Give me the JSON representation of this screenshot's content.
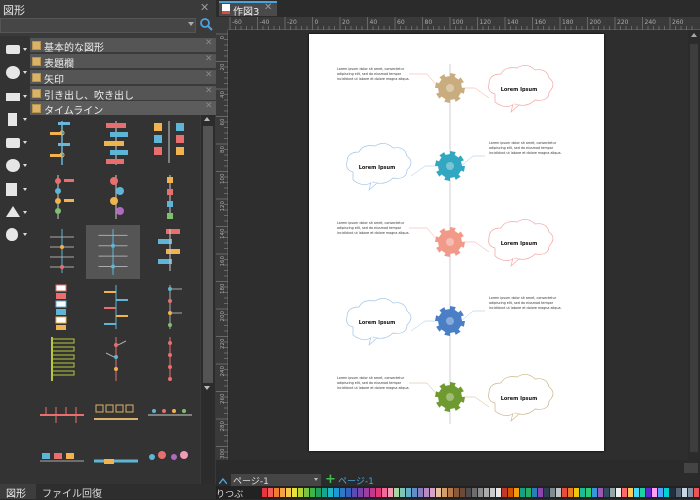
{
  "left_panel": {
    "title": "図形",
    "close": "✕",
    "libraries": [
      {
        "label": "基本的な図形",
        "close": "✕"
      },
      {
        "label": "表題欄",
        "close": "✕"
      },
      {
        "label": "矢印",
        "close": "✕"
      },
      {
        "label": "引き出し、吹き出し",
        "close": "✕"
      },
      {
        "label": "タイムライン",
        "close": "✕"
      }
    ],
    "category_icons": [
      "rectangle-icon",
      "pie-chart-icon",
      "truck-icon",
      "device-icon",
      "camera-icon",
      "heart-badge-icon",
      "people-icon",
      "triangle-shapes-icon",
      "apple-icon"
    ],
    "bottom_tabs": [
      "図形",
      "ファイル回復"
    ]
  },
  "document": {
    "tab_label": "作図3",
    "tab_close": "✕",
    "ruler_h_labels": [
      "-60",
      "-40",
      "-20",
      "0",
      "20",
      "40",
      "60",
      "80",
      "100",
      "120",
      "140",
      "160",
      "180",
      "200",
      "220",
      "240",
      "260"
    ],
    "ruler_v_labels": [
      "0",
      "20",
      "40",
      "60",
      "80",
      "100",
      "120",
      "140",
      "160",
      "180",
      "200",
      "220",
      "240",
      "260",
      "280",
      "300"
    ]
  },
  "timeline": {
    "body_text": [
      "Lorem ipsum dolor sit amet, consectetur",
      "adipiscing elit, sed do eiusmod tempor",
      "incididunt ut labore et dolore magna aliqua."
    ],
    "cloud_text": "Lorem Ipsum",
    "node_colors": [
      "#c9ad7f",
      "#32a7c1",
      "#f29a8a",
      "#4a7fc6",
      "#6e9a2f"
    ],
    "cloud_colors": [
      "#f2a3a0",
      "#9ec4e6",
      "#f2a3a0",
      "#9ec4e6",
      "#c9b48a"
    ]
  },
  "status": {
    "page_select": "ページ-1",
    "page_tab": "ページ-1",
    "add_page": "+",
    "colors_label": "りつぶ"
  },
  "palette_colors": [
    "#e8363c",
    "#f25b5b",
    "#ee7f2d",
    "#f4a347",
    "#f7c94b",
    "#e8e23a",
    "#b5d334",
    "#7fc241",
    "#3ab54a",
    "#1f9e5c",
    "#17a68f",
    "#1fb8c2",
    "#1a9bd7",
    "#2e7bc4",
    "#3b5fbf",
    "#5b4bb4",
    "#7a45a8",
    "#9c3fa0",
    "#c23a8e",
    "#e23877",
    "#f06a9a",
    "#f49ab6",
    "#a7d7a0",
    "#7fc5b4",
    "#60b0c7",
    "#5f8fc6",
    "#8a7cc1",
    "#b68bc2",
    "#d7a2c8",
    "#e8c1a0",
    "#d4a06a",
    "#b5794a",
    "#8a5a3b",
    "#6b4a3a",
    "#4d4d4d",
    "#6d6d6d",
    "#8c8c8c",
    "#ababab",
    "#cacaca",
    "#e8e8e8",
    "#c0392b",
    "#d35400",
    "#f39c12",
    "#16a085",
    "#27ae60",
    "#2980b9",
    "#8e44ad",
    "#2c3e50",
    "#7f8c8d",
    "#bdc3c7",
    "#e74c3c",
    "#e67e22",
    "#f1c40f",
    "#1abc9c",
    "#2ecc71",
    "#3498db",
    "#9b59b6",
    "#34495e",
    "#95a5a6",
    "#ecf0f1",
    "#ff6b6b",
    "#feca57",
    "#48dbfb",
    "#1dd1a1",
    "#5f27cd",
    "#ff9ff3",
    "#54a0ff",
    "#00d2d3",
    "#222f3e",
    "#576574",
    "#c8d6e5",
    "#8395a7",
    "#ee5253",
    "#0abde3",
    "#10ac84",
    "#341f97",
    "#f368e0",
    "#ff9f43"
  ]
}
